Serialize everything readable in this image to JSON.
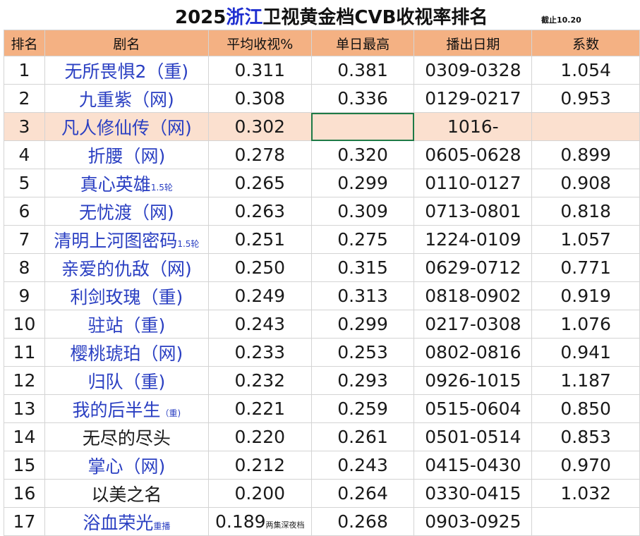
{
  "title": {
    "pre": "2025",
    "highlight": "浙江",
    "post": "卫视黄金档CVB收视率排名",
    "as_of": "截止10.20"
  },
  "headers": [
    "排名",
    "剧名",
    "平均收视%",
    "单日最高",
    "播出日期",
    "系数"
  ],
  "rows": [
    {
      "rank": "1",
      "name": "无所畏惧2（重)",
      "suffix": "",
      "avg": "0.311",
      "avg_note": "",
      "peak": "0.381",
      "dates": "0309-0328",
      "coef": "1.054",
      "name_color": "blue"
    },
    {
      "rank": "2",
      "name": "九重紫（网)",
      "suffix": "",
      "avg": "0.308",
      "avg_note": "",
      "peak": "0.336",
      "dates": "0129-0217",
      "coef": "0.953",
      "name_color": "blue"
    },
    {
      "rank": "3",
      "name": "凡人修仙传（网)",
      "suffix": "",
      "avg": "0.302",
      "avg_note": "",
      "peak": "",
      "dates": "1016-",
      "coef": "",
      "name_color": "blue"
    },
    {
      "rank": "4",
      "name": "折腰（网)",
      "suffix": "",
      "avg": "0.278",
      "avg_note": "",
      "peak": "0.320",
      "dates": "0605-0628",
      "coef": "0.899",
      "name_color": "blue"
    },
    {
      "rank": "5",
      "name": "真心英雄",
      "suffix": "1.5轮",
      "avg": "0.265",
      "avg_note": "",
      "peak": "0.299",
      "dates": "0110-0127",
      "coef": "0.908",
      "name_color": "blue"
    },
    {
      "rank": "6",
      "name": "无忧渡（网)",
      "suffix": "",
      "avg": "0.263",
      "avg_note": "",
      "peak": "0.309",
      "dates": "0713-0801",
      "coef": "0.818",
      "name_color": "blue"
    },
    {
      "rank": "7",
      "name": "清明上河图密码",
      "suffix": "1.5轮",
      "avg": "0.251",
      "avg_note": "",
      "peak": "0.275",
      "dates": "1224-0109",
      "coef": "1.057",
      "name_color": "blue"
    },
    {
      "rank": "8",
      "name": "亲爱的仇敌（网)",
      "suffix": "",
      "avg": "0.250",
      "avg_note": "",
      "peak": "0.315",
      "dates": "0629-0712",
      "coef": "0.771",
      "name_color": "blue"
    },
    {
      "rank": "9",
      "name": "利剑玫瑰（重)",
      "suffix": "",
      "avg": "0.249",
      "avg_note": "",
      "peak": "0.313",
      "dates": "0818-0902",
      "coef": "0.919",
      "name_color": "blue"
    },
    {
      "rank": "10",
      "name": "驻站（重)",
      "suffix": "",
      "avg": "0.243",
      "avg_note": "",
      "peak": "0.299",
      "dates": "0217-0308",
      "coef": "1.076",
      "name_color": "blue"
    },
    {
      "rank": "11",
      "name": "樱桃琥珀（网)",
      "suffix": "",
      "avg": "0.233",
      "avg_note": "",
      "peak": "0.253",
      "dates": "0802-0816",
      "coef": "0.941",
      "name_color": "blue"
    },
    {
      "rank": "12",
      "name": "归队（重)",
      "suffix": "",
      "avg": "0.232",
      "avg_note": "",
      "peak": "0.293",
      "dates": "0926-1015",
      "coef": "1.187",
      "name_color": "blue"
    },
    {
      "rank": "13",
      "name": "我的后半生",
      "suffix": "（重)",
      "avg": "0.221",
      "avg_note": "",
      "peak": "0.259",
      "dates": "0515-0604",
      "coef": "0.850",
      "name_color": "blue"
    },
    {
      "rank": "14",
      "name": "无尽的尽头",
      "suffix": "",
      "avg": "0.220",
      "avg_note": "",
      "peak": "0.261",
      "dates": "0501-0514",
      "coef": "0.853",
      "name_color": "black"
    },
    {
      "rank": "15",
      "name": "掌心（网)",
      "suffix": "",
      "avg": "0.212",
      "avg_note": "",
      "peak": "0.243",
      "dates": "0415-0430",
      "coef": "0.970",
      "name_color": "blue"
    },
    {
      "rank": "16",
      "name": "以美之名",
      "suffix": "",
      "avg": "0.200",
      "avg_note": "",
      "peak": "0.264",
      "dates": "0330-0415",
      "coef": "1.032",
      "name_color": "black"
    },
    {
      "rank": "17",
      "name": "浴血荣光",
      "suffix": "重播",
      "avg": "0.189",
      "avg_note": "两集深夜档",
      "peak": "0.268",
      "dates": "0903-0925",
      "coef": "",
      "name_color": "blue"
    }
  ]
}
